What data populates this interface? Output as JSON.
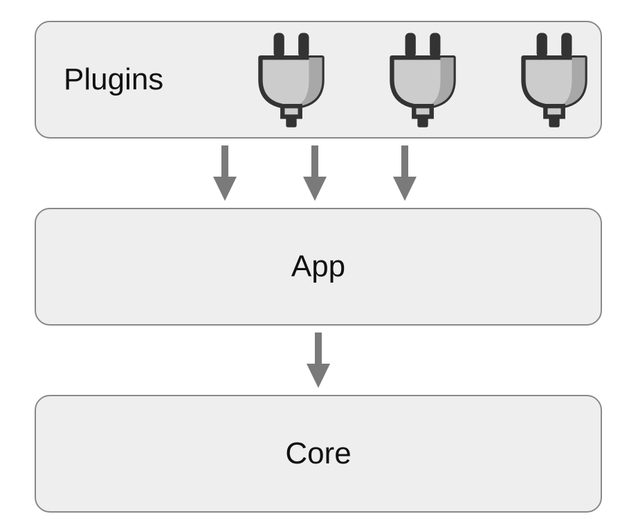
{
  "boxes": {
    "plugins": {
      "label": "Plugins"
    },
    "app": {
      "label": "App"
    },
    "core": {
      "label": "Core"
    }
  },
  "colors": {
    "boxFill": "#eeeeee",
    "boxStroke": "#888888",
    "arrow": "#7a7a7a",
    "plugDark": "#333333",
    "plugBody": "#cccccc",
    "plugShade": "#a8a8a8"
  }
}
